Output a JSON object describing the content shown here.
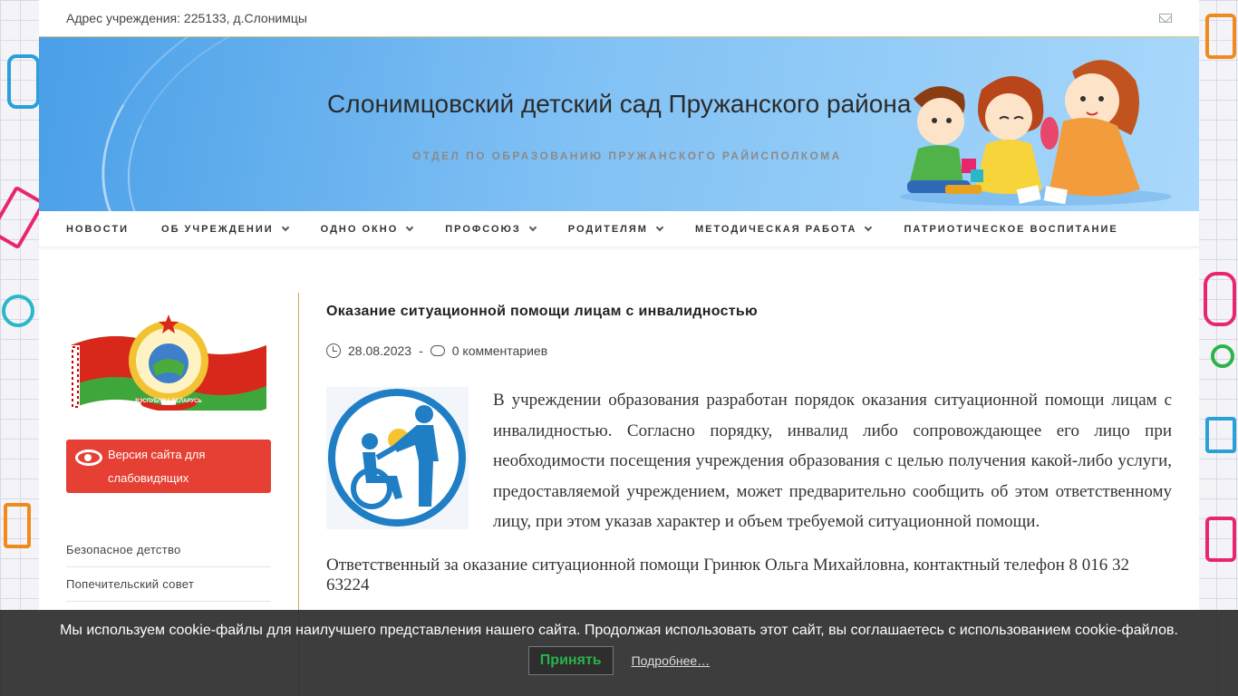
{
  "topbar": {
    "address": "Адрес учреждения: 225133, д.Слонимцы",
    "mail_icon": "mail-icon"
  },
  "header": {
    "title": "Слонимцовский детский сад Пружанского района",
    "description": "ОТДЕЛ ПО ОБРАЗОВАНИЮ ПРУЖАНСКОГО РАЙИСПОЛКОМА"
  },
  "nav": {
    "items": [
      {
        "label": "НОВОСТИ",
        "dropdown": false
      },
      {
        "label": "ОБ УЧРЕЖДЕНИИ",
        "dropdown": true
      },
      {
        "label": "ОДНО ОКНО",
        "dropdown": true
      },
      {
        "label": "ПРОФСОЮЗ",
        "dropdown": true
      },
      {
        "label": "РОДИТЕЛЯМ",
        "dropdown": true
      },
      {
        "label": "МЕТОДИЧЕСКАЯ РАБОТА",
        "dropdown": true
      },
      {
        "label": "ПАТРИОТИЧЕСКОЕ ВОСПИТАНИЕ",
        "dropdown": false
      }
    ]
  },
  "sidebar": {
    "emblem_text": "РЭСПУБЛІКА БЕЛАРУСЬ",
    "visually_impaired_label": "Версия сайта для слабовидящих",
    "links": [
      "Безопасное детство",
      "Попечительский совет"
    ]
  },
  "post": {
    "title": "Оказание ситуационной помощи лицам с инвалидностью",
    "date": "28.08.2023",
    "separator": "-",
    "comments": "0 комментариев",
    "paragraph": "В учреждении образования разработан порядок оказания ситуационной помощи лицам с инвалидностью. Согласно порядку, инвалид либо сопровождающее его лицо при необходимости посещения учреждения образования с целью получения какой-либо услуги, предоставляемой учреждением, может предварительно сообщить об этом ответственному лицу, при этом указав характер и объем требуемой ситуационной помощи.",
    "responsible": "Ответственный за оказание ситуационной помощи Гринюк Ольга Михайловна, контактный телефон 8 016 32 63224"
  },
  "cookie": {
    "text": "Мы используем cookie-файлы для наилучшего представления нашего сайта. Продолжая использовать этот сайт, вы соглашаетесь с использованием cookie-файлов.",
    "accept_label": "Принять",
    "more_label": "Подробнее…"
  },
  "colors": {
    "accent_red": "#e63f33",
    "cookie_accept_green": "#27b34a",
    "sidebar_divider": "#c9a85a"
  }
}
